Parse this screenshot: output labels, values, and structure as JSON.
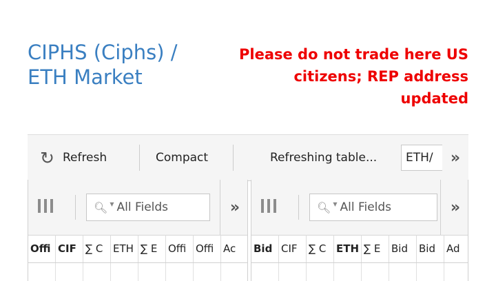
{
  "title": {
    "line1": "CIPHS (Ciphs) /",
    "line2": "ETH Market"
  },
  "notice": {
    "line1": "Please do not trade here US",
    "line2": "citizens; REP address",
    "line3": "updated"
  },
  "toolbar": {
    "refresh_icon": "↻",
    "refresh_label": "Refresh",
    "compact_label": "Compact",
    "status_label": "Refreshing table...",
    "pair_value": "ETH/",
    "more_icon": "»"
  },
  "offers_panel": {
    "columns_icon": "columns-icon",
    "search_placeholder": "All Fields",
    "more_icon": "»",
    "headers": [
      "Offi",
      "CIF",
      "∑ C",
      "ETH",
      "∑ E",
      "Offi",
      "Offi",
      "Ac"
    ]
  },
  "bids_panel": {
    "columns_icon": "columns-icon",
    "search_placeholder": "All Fields",
    "more_icon": "»",
    "headers": [
      "Bid",
      "CIF",
      "∑ C",
      "ETH",
      "∑ E",
      "Bid",
      "Bid",
      "Ad"
    ]
  },
  "colors": {
    "title": "#3a7fc1",
    "notice": "#ee0000",
    "toolbar_bg": "#f5f5f5"
  }
}
